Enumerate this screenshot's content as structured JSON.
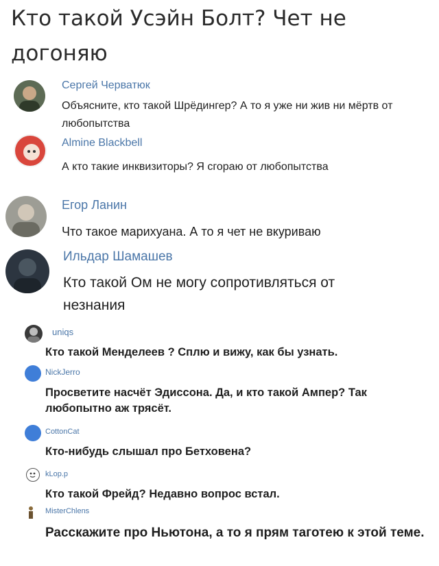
{
  "title": "Кто такой Усэйн Болт? Чет не догоняю",
  "comments": [
    {
      "author": "Сергей Черватюк",
      "text": "Объясните, кто такой Шрёдингер? А то я уже ни жив ни мёртв от любопытства"
    },
    {
      "author": "Almine Blackbell",
      "text": "А кто такие инквизиторы? Я сгораю от любопытства"
    },
    {
      "author": "Егор Ланин",
      "text": "Что такое марихуана. А то я чет не вкуриваю"
    },
    {
      "author": "Ильдар Шамашев",
      "text": "Кто такой Ом не могу сопротивляться от незнания"
    },
    {
      "author": "uniqs",
      "text": "Кто такой Менделеев ? Сплю и вижу, как бы узнать."
    },
    {
      "author": "NickJerro",
      "text": "Просветите насчёт Эдиссона. Да, и кто такой Ампер? Так любопытно аж трясёт."
    },
    {
      "author": "CottonCat",
      "text": "Кто-нибудь слышал про Бетховена?"
    },
    {
      "author": "kLop.p",
      "text": "Кто такой Фрейд? Недавно вопрос встал."
    },
    {
      "author": "MisterChlens",
      "text": "Расскажите про Ньютона, а то я прям таготею к этой теме."
    }
  ]
}
